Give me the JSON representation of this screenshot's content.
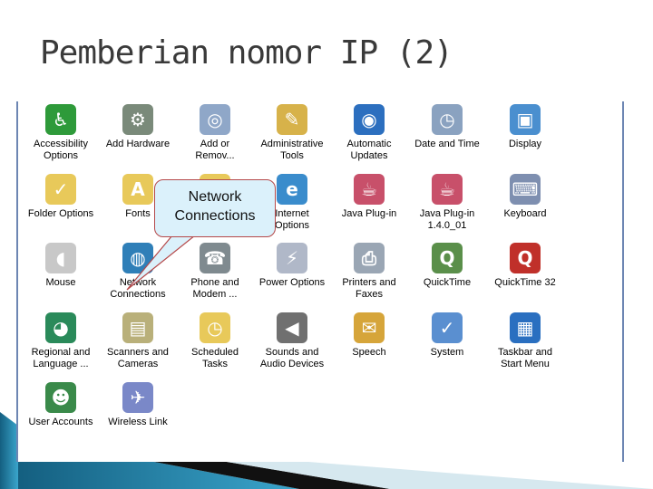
{
  "title": "Pemberian nomor IP (2)",
  "callout": {
    "line1": "Network",
    "line2": "Connections"
  },
  "colors": {
    "panel_border": "#6d86b3",
    "callout_fill": "#dbf1fb",
    "callout_border": "#b5494a",
    "deco_teal": "#1d7fa6"
  },
  "items": [
    {
      "l1": "Accessibility",
      "l2": "Options",
      "icon": "accessibility-icon",
      "c": "#2e9a3a",
      "g": "♿"
    },
    {
      "l1": "Add Hardware",
      "l2": "",
      "icon": "hardware-icon",
      "c": "#7a8a7a",
      "g": "⚙"
    },
    {
      "l1": "Add or",
      "l2": "Remov...",
      "icon": "cd-icon",
      "c": "#8fa7c8",
      "g": "◎"
    },
    {
      "l1": "Administrative",
      "l2": "Tools",
      "icon": "tools-icon",
      "c": "#d7b24a",
      "g": "✎"
    },
    {
      "l1": "Automatic",
      "l2": "Updates",
      "icon": "windows-globe-icon",
      "c": "#2c6fbf",
      "g": "◉"
    },
    {
      "l1": "Date and Time",
      "l2": "",
      "icon": "clock-icon",
      "c": "#8aa2c0",
      "g": "◷"
    },
    {
      "l1": "Display",
      "l2": "",
      "icon": "monitor-icon",
      "c": "#4a8fcf",
      "g": "▣"
    },
    {
      "l1": "Folder Options",
      "l2": "",
      "icon": "folder-check-icon",
      "c": "#e8c95a",
      "g": "✓"
    },
    {
      "l1": "Fonts",
      "l2": "",
      "icon": "fonts-folder-icon",
      "c": "#e8c95a",
      "g": "A"
    },
    {
      "l1": "",
      "l2": "",
      "icon": "network-folder-icon",
      "c": "#e8c95a",
      "g": ""
    },
    {
      "l1": "Internet",
      "l2": "Options",
      "icon": "internet-globe-icon",
      "c": "#3a8ccc",
      "g": "e"
    },
    {
      "l1": "Java Plug-in",
      "l2": "",
      "icon": "java-cup-icon",
      "c": "#c8506a",
      "g": "☕"
    },
    {
      "l1": "Java Plug-in",
      "l2": "1.4.0_01",
      "icon": "java-cup-icon",
      "c": "#c8506a",
      "g": "☕"
    },
    {
      "l1": "Keyboard",
      "l2": "",
      "icon": "keyboard-icon",
      "c": "#7e8fb0",
      "g": "⌨"
    },
    {
      "l1": "Mouse",
      "l2": "",
      "icon": "mouse-icon",
      "c": "#c8c8c8",
      "g": "◖"
    },
    {
      "l1": "Network",
      "l2": "Connections",
      "icon": "network-globe-icon",
      "c": "#2f7fb8",
      "g": "◍"
    },
    {
      "l1": "Phone and",
      "l2": "Modem ...",
      "icon": "phone-icon",
      "c": "#7f8a8f",
      "g": "☎"
    },
    {
      "l1": "Power Options",
      "l2": "",
      "icon": "power-plug-icon",
      "c": "#b0b8c8",
      "g": "⚡"
    },
    {
      "l1": "Printers and",
      "l2": "Faxes",
      "icon": "printer-icon",
      "c": "#9aa6b4",
      "g": "⎙"
    },
    {
      "l1": "QuickTime",
      "l2": "",
      "icon": "quicktime-icon",
      "c": "#5a8f4a",
      "g": "Q"
    },
    {
      "l1": "QuickTime 32",
      "l2": "",
      "icon": "quicktime32-icon",
      "c": "#c0302a",
      "g": "Q"
    },
    {
      "l1": "Regional and",
      "l2": "Language ...",
      "icon": "globe-stand-icon",
      "c": "#2a8a5a",
      "g": "◕"
    },
    {
      "l1": "Scanners and",
      "l2": "Cameras",
      "icon": "scanner-icon",
      "c": "#b9b07a",
      "g": "▤"
    },
    {
      "l1": "Scheduled",
      "l2": "Tasks",
      "icon": "scheduled-folder-icon",
      "c": "#e8c95a",
      "g": "◷"
    },
    {
      "l1": "Sounds and",
      "l2": "Audio Devices",
      "icon": "speaker-icon",
      "c": "#707070",
      "g": "◀"
    },
    {
      "l1": "Speech",
      "l2": "",
      "icon": "speech-icon",
      "c": "#d6a53a",
      "g": "✉"
    },
    {
      "l1": "System",
      "l2": "",
      "icon": "computer-icon",
      "c": "#5a8fd0",
      "g": "✓"
    },
    {
      "l1": "Taskbar and",
      "l2": "Start Menu",
      "icon": "taskbar-icon",
      "c": "#2a6fc0",
      "g": "▦"
    },
    {
      "l1": "User Accounts",
      "l2": "",
      "icon": "users-icon",
      "c": "#3a8a4a",
      "g": "☻"
    },
    {
      "l1": "Wireless Link",
      "l2": "",
      "icon": "wireless-laptop-icon",
      "c": "#7a88c8",
      "g": "✈"
    }
  ]
}
